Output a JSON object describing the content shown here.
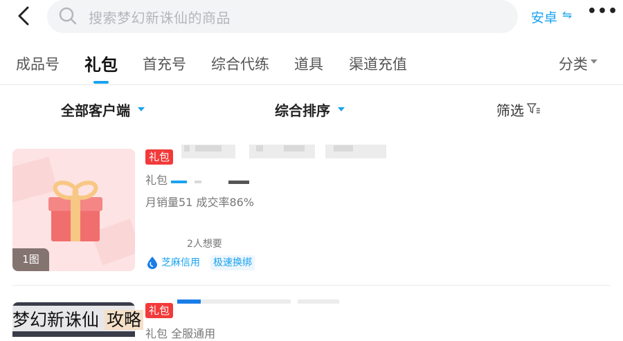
{
  "header": {
    "search_placeholder": "搜索梦幻新诛仙的商品",
    "platform_label": "安卓",
    "platform_switch_glyph": "⇋",
    "more_glyph": "•••"
  },
  "tabs": [
    {
      "label": "成品号",
      "active": false
    },
    {
      "label": "礼包",
      "active": true
    },
    {
      "label": "首充号",
      "active": false
    },
    {
      "label": "综合代练",
      "active": false
    },
    {
      "label": "道具",
      "active": false
    },
    {
      "label": "渠道充值",
      "active": false
    }
  ],
  "category_label": "分类",
  "filters": {
    "client": "全部客户端",
    "sort": "综合排序",
    "screen": "筛选"
  },
  "items": [
    {
      "badge": "礼包",
      "subtitle": "礼包",
      "stats": "月销量51 成交率86%",
      "want": "2人想要",
      "image_count": "1图",
      "tags": [
        "芝麻信用",
        "极速换绑"
      ]
    },
    {
      "badge": "礼包",
      "subtitle": "礼包 全服通用",
      "thumb_text_a": "梦幻新诛仙",
      "thumb_text_b": "攻略"
    }
  ],
  "colors": {
    "accent": "#1aa3ef",
    "badge_red": "#f23a3a"
  }
}
